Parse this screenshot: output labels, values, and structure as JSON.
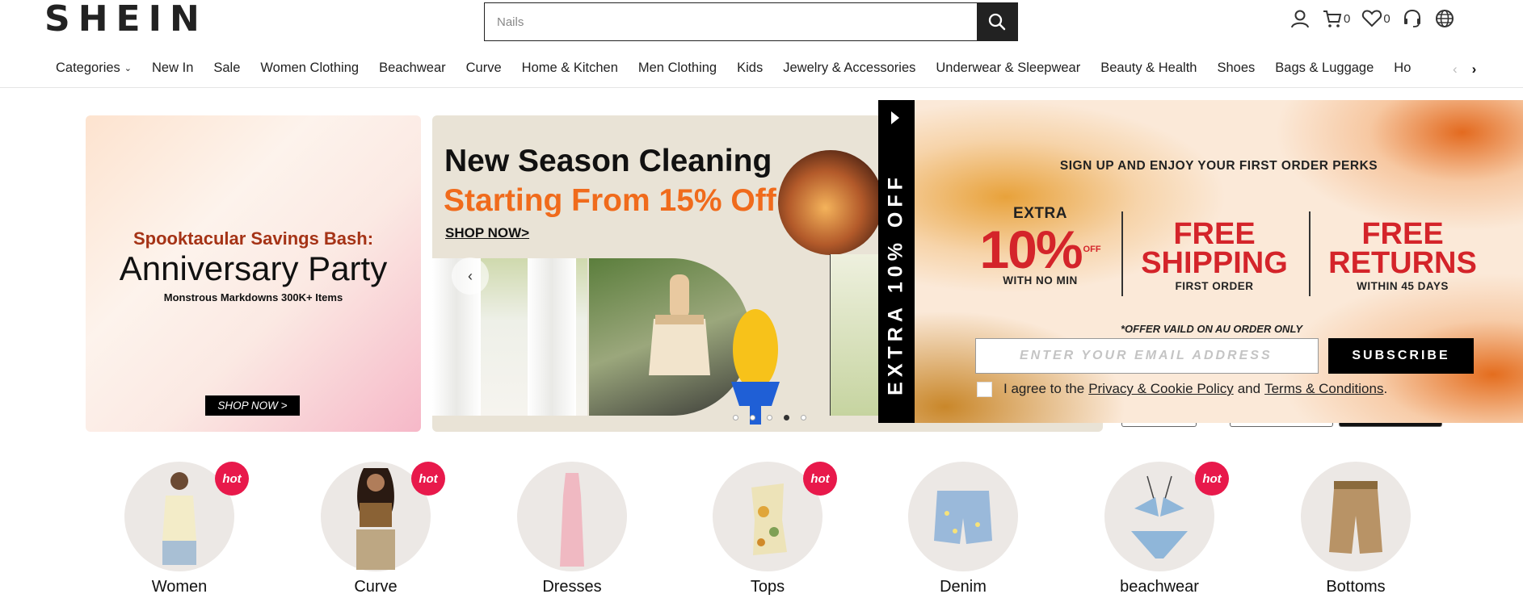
{
  "header": {
    "logo": "SHEIN",
    "search_placeholder": "Nails",
    "cart_count": "0",
    "wishlist_count": "0"
  },
  "nav": {
    "items": [
      "Categories",
      "New In",
      "Sale",
      "Women Clothing",
      "Beachwear",
      "Curve",
      "Home & Kitchen",
      "Men Clothing",
      "Kids",
      "Jewelry & Accessories",
      "Underwear & Sleepwear",
      "Beauty & Health",
      "Shoes",
      "Bags & Luggage",
      "Ho"
    ]
  },
  "banner_left": {
    "title1": "Spooktacular Savings Bash:",
    "title2": "Anniversary Party",
    "subtitle": "Monstrous Markdowns 300K+ Items",
    "cta": "SHOP NOW >"
  },
  "banner_mid": {
    "title1": "New Season Cleaning",
    "title2": "Starting From 15% Off",
    "cta": "SHOP NOW>",
    "active_slide": 4,
    "slide_count": 5
  },
  "popup": {
    "strip_text": "EXTRA 10% OFF",
    "heading": "SIGN UP AND ENJOY YOUR FIRST ORDER PERKS",
    "perk1_top": "EXTRA",
    "perk1_big": "10%",
    "perk1_of": "OFF",
    "perk1_bottom": "WITH NO MIN",
    "perk2_line1": "FREE",
    "perk2_line2": "SHIPPING",
    "perk2_bottom": "FIRST ORDER",
    "perk3_line1": "FREE",
    "perk3_line2": "RETURNS",
    "perk3_bottom": "WITHIN 45 DAYS",
    "note": "*OFFER VAILD ON AU ORDER ONLY",
    "email_placeholder": "ENTER YOUR EMAIL ADDRESS",
    "subscribe": "SUBSCRIBE",
    "agree_prefix": "I agree to the",
    "privacy_link": "Privacy & Cookie Policy",
    "and": "and",
    "terms_link": "Terms & Conditions",
    "period": "."
  },
  "categories": [
    {
      "label": "Women",
      "hot": true
    },
    {
      "label": "Curve",
      "hot": true
    },
    {
      "label": "Dresses",
      "hot": false
    },
    {
      "label": "Tops",
      "hot": true
    },
    {
      "label": "Denim",
      "hot": false
    },
    {
      "label": "beachwear",
      "hot": true
    },
    {
      "label": "Bottoms",
      "hot": false
    }
  ],
  "hot_badge": "hot",
  "colors": {
    "accent_red": "#d4242a",
    "orange": "#f06b1c",
    "hot_badge": "#e8194b"
  }
}
